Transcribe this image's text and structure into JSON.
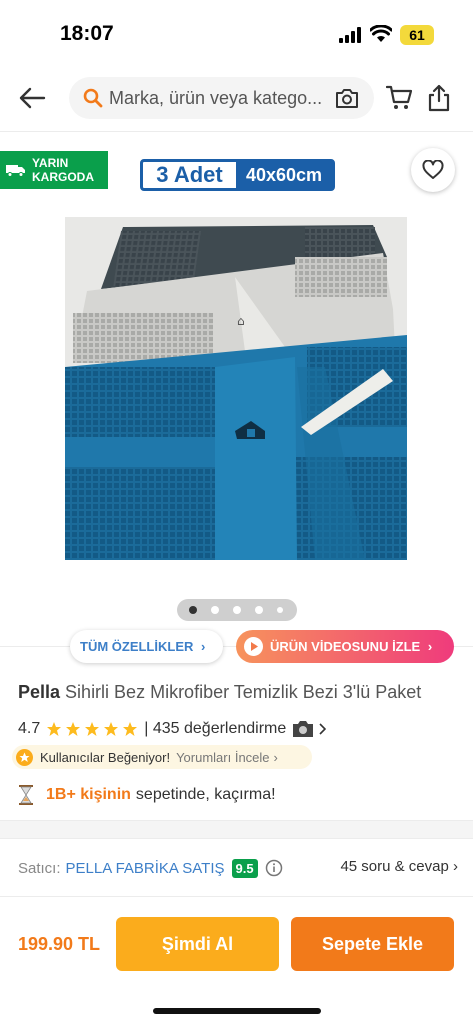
{
  "status_bar": {
    "time": "18:07",
    "battery": "61"
  },
  "search": {
    "placeholder": "Marka, ürün veya katego..."
  },
  "badges": {
    "delivery_line1": "YARIN",
    "delivery_line2": "KARGODA",
    "quantity": "3 Adet",
    "size": "40x60cm"
  },
  "image_dots": {
    "count": 5,
    "active": 0
  },
  "actions": {
    "features": "TÜM ÖZELLİKLER",
    "features_chevron": "›",
    "video": "ÜRÜN VİDEOSUNU İZLE",
    "video_chevron": "›"
  },
  "product": {
    "brand": "Pella",
    "title": "Sihirli Bez Mikrofiber Temizlik Bezi 3'lü Paket",
    "rating": "4.7",
    "stars": 5,
    "review_count": "| 435 değerlendirme"
  },
  "liked": {
    "label": "Kullanıcılar Beğeniyor!",
    "link": "Yorumları İncele",
    "chevron": "›"
  },
  "basket": {
    "count": "1B+ kişinin",
    "text": "sepetinde, kaçırma!"
  },
  "seller": {
    "label": "Satıcı:",
    "name": "PELLA FABRİKA SATIŞ",
    "score": "9.5",
    "qa": "45 soru & cevap ›"
  },
  "checkout": {
    "price": "199.90 TL",
    "buy_now": "Şimdi Al",
    "add_to_cart": "Sepete Ekle"
  },
  "colors": {
    "brand_orange": "#f27a1a",
    "buy_yellow": "#fbac1c",
    "green": "#0a9f4b",
    "blue": "#1b5fa8"
  }
}
